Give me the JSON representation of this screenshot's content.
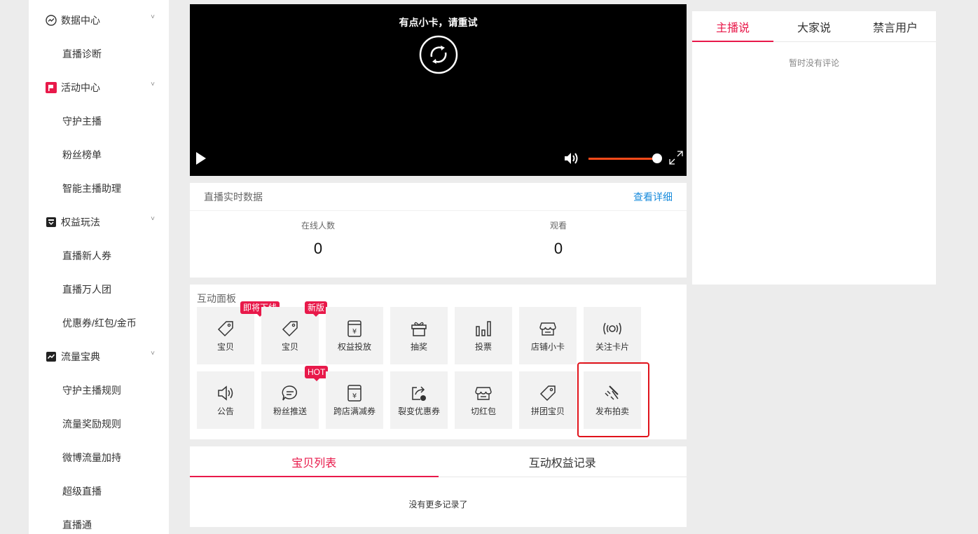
{
  "sidebar": {
    "groups": [
      {
        "label": "数据中心",
        "icon": "chart-circle-icon",
        "chevron": "˅"
      },
      {
        "label": "活动中心",
        "icon": "flag-icon",
        "chevron": "˅"
      },
      {
        "label": "权益玩法",
        "icon": "gift-box-icon",
        "chevron": "˅"
      },
      {
        "label": "流量宝典",
        "icon": "trend-icon",
        "chevron": "˅"
      }
    ],
    "items": [
      "直播诊断",
      "守护主播",
      "粉丝榜单",
      "智能主播助理",
      "直播新人券",
      "直播万人团",
      "优惠券/红包/金币",
      "守护主播规则",
      "流量奖励规则",
      "微博流量加持",
      "超级直播",
      "直播通"
    ]
  },
  "video": {
    "message": "有点小卡，请重试",
    "volume": 0.9
  },
  "realtime": {
    "title": "直播实时数据",
    "detail_link": "查看详细",
    "stats": [
      {
        "label": "在线人数",
        "value": "0"
      },
      {
        "label": "观看",
        "value": "0"
      }
    ]
  },
  "interaction": {
    "title": "互动面板",
    "tiles": [
      {
        "label": "宝贝",
        "icon": "tag-icon",
        "badge": "即将下线"
      },
      {
        "label": "宝贝",
        "icon": "tag-icon",
        "badge": "新版"
      },
      {
        "label": "权益投放",
        "icon": "yuan-box-icon",
        "badge": ""
      },
      {
        "label": "抽奖",
        "icon": "gift-icon",
        "badge": ""
      },
      {
        "label": "投票",
        "icon": "bar-chart-icon",
        "badge": ""
      },
      {
        "label": "店铺小卡",
        "icon": "store-icon",
        "badge": ""
      },
      {
        "label": "关注卡片",
        "icon": "broadcast-icon",
        "badge": ""
      },
      {
        "label": "公告",
        "icon": "speaker-icon",
        "badge": ""
      },
      {
        "label": "粉丝推送",
        "icon": "message-icon",
        "badge": "HOT"
      },
      {
        "label": "跨店满减券",
        "icon": "yuan-box-icon",
        "badge": ""
      },
      {
        "label": "裂变优惠券",
        "icon": "share-coupon-icon",
        "badge": ""
      },
      {
        "label": "切红包",
        "icon": "store-icon",
        "badge": ""
      },
      {
        "label": "拼团宝贝",
        "icon": "tag-icon",
        "badge": ""
      },
      {
        "label": "发布拍卖",
        "icon": "auction-hammer-icon",
        "badge": ""
      }
    ]
  },
  "bottom_tabs": {
    "tabs": [
      "宝贝列表",
      "互动权益记录"
    ],
    "empty": "没有更多记录了"
  },
  "comments": {
    "tabs": [
      "主播说",
      "大家说",
      "禁言用户"
    ],
    "empty": "暂时没有评论"
  },
  "colors": {
    "accent": "#e8194a",
    "link": "#1a8cdc",
    "highlight": "#e0131b",
    "volume": "#ff4a1a"
  }
}
